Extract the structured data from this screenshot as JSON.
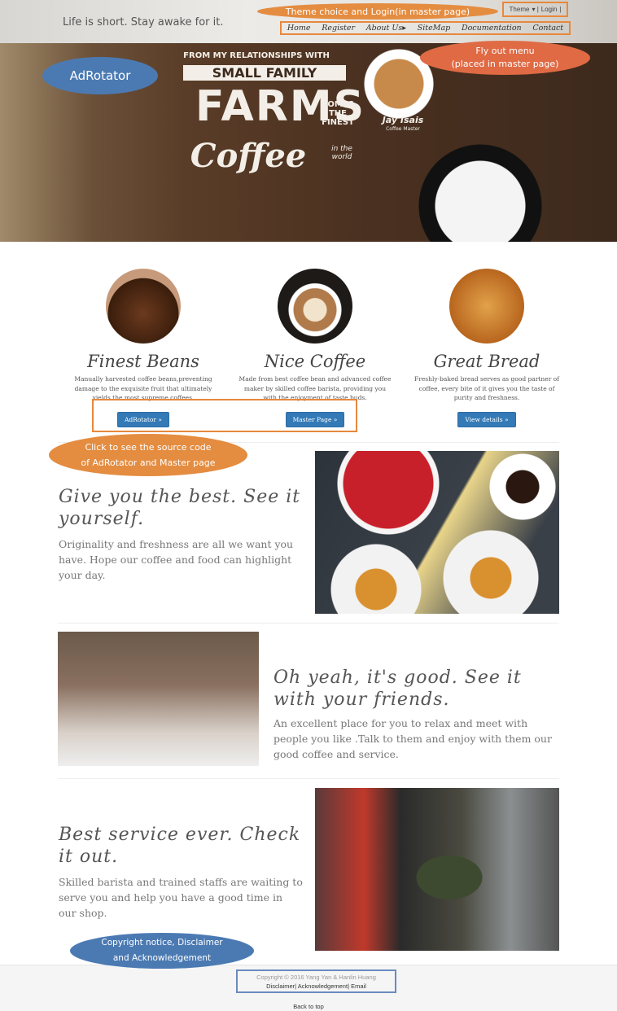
{
  "header": {
    "tagline": "Life is short. Stay awake for it.",
    "theme": "Theme",
    "login": "Login",
    "nav": [
      "Home",
      "Register",
      "About Us",
      "SiteMap",
      "Documentation",
      "Contact"
    ]
  },
  "hero": {
    "line1": "FROM MY RELATIONSHIPS WITH",
    "line2": "SMALL FAMILY",
    "line3": "FARMS",
    "line4": "COMES THE FINEST",
    "line5": "Coffee",
    "line6": "in the world",
    "author": "Jay Isais",
    "author_role": "Coffee Master"
  },
  "features": [
    {
      "title": "Finest Beans",
      "text": "Manually harvested coffee beans,preventing damage to the exquisite fruit that ultimately yields the most supreme coffees.",
      "button": "AdRotator »"
    },
    {
      "title": "Nice Coffee",
      "text": "Made from best coffee bean and advanced coffee maker by skilled coffee barista, providing you with the enjoyment of taste buds.",
      "button": "Master Page »"
    },
    {
      "title": "Great Bread",
      "text": "Freshly-baked bread serves as good partner of coffee, every bite of it gives you the taste of purity and freshness.",
      "button": "View details »"
    }
  ],
  "sections": [
    {
      "heading": "Give you the best. See it yourself.",
      "text": "Originality and freshness are all we want you have. Hope our coffee and food can highlight your day."
    },
    {
      "heading": "Oh yeah, it's good. See it with your friends.",
      "text": "An excellent place for you to relax and meet with people you like .Talk to them and enjoy with them our good coffee and service."
    },
    {
      "heading": "Best service ever. Check it out.",
      "text": "Skilled barista and trained staffs are waiting to serve you and help you have a good time in our shop."
    }
  ],
  "footer": {
    "copyright": "Copyright © 2016 Yang Yan & Hanlin Huang",
    "disclaimer": "Disclaimer",
    "acknowledgement": "Acknowledgement",
    "email": "Email",
    "back_to_top": "Back to top"
  },
  "annotations": {
    "theme_login": "Theme choice and Login(in master page)",
    "flyout1": "Fly out menu",
    "flyout2": "(placed in master page)",
    "adrotator": "AdRotator",
    "source1": "Click to see the source code",
    "source2": "of AdRotator and Master page",
    "copyright1": "Copyright notice, Disclaimer",
    "copyright2": "and Acknowledgement"
  }
}
